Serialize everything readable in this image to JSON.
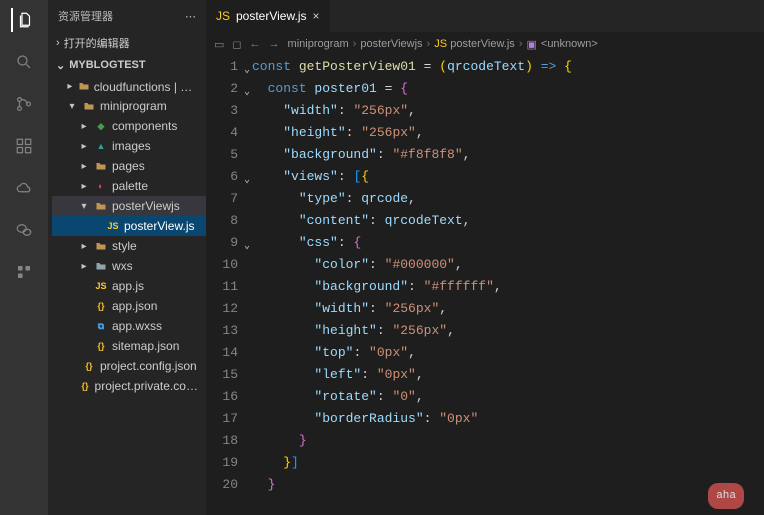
{
  "activity": {
    "icons": [
      "files",
      "search",
      "scm",
      "debug",
      "extensions",
      "cloud",
      "wechat",
      "more"
    ]
  },
  "sidebar": {
    "title": "资源管理器",
    "section_open": "打开的编辑器",
    "project": "MYBLOGTEST",
    "tree": [
      {
        "depth": 1,
        "arrow": "▸",
        "icon": "folder",
        "iconCls": "ic-folder",
        "label": "cloudfunctions | 当前环境: blo..."
      },
      {
        "depth": 1,
        "arrow": "▾",
        "icon": "folder",
        "iconCls": "ic-folder-open",
        "label": "miniprogram"
      },
      {
        "depth": 2,
        "arrow": "▸",
        "icon": "comp",
        "iconCls": "ic-comp",
        "label": "components"
      },
      {
        "depth": 2,
        "arrow": "▸",
        "icon": "img",
        "iconCls": "ic-img",
        "label": "images"
      },
      {
        "depth": 2,
        "arrow": "▸",
        "icon": "folder",
        "iconCls": "ic-folder",
        "label": "pages"
      },
      {
        "depth": 2,
        "arrow": "▸",
        "icon": "pal",
        "iconCls": "ic-pal",
        "label": "palette"
      },
      {
        "depth": 2,
        "arrow": "▾",
        "icon": "folder",
        "iconCls": "ic-folder-open",
        "label": "posterViewjs",
        "selected": true
      },
      {
        "depth": 3,
        "arrow": "",
        "icon": "js",
        "iconCls": "ic-js",
        "label": "posterView.js",
        "active": true
      },
      {
        "depth": 2,
        "arrow": "▸",
        "icon": "folder",
        "iconCls": "ic-folder",
        "label": "style"
      },
      {
        "depth": 2,
        "arrow": "▸",
        "icon": "folder",
        "iconCls": "ic-grey",
        "label": "wxs"
      },
      {
        "depth": 2,
        "arrow": "",
        "icon": "js",
        "iconCls": "ic-js",
        "label": "app.js"
      },
      {
        "depth": 2,
        "arrow": "",
        "icon": "json",
        "iconCls": "ic-json",
        "label": "app.json"
      },
      {
        "depth": 2,
        "arrow": "",
        "icon": "wxss",
        "iconCls": "ic-wxss",
        "label": "app.wxss"
      },
      {
        "depth": 2,
        "arrow": "",
        "icon": "json",
        "iconCls": "ic-json",
        "label": "sitemap.json"
      },
      {
        "depth": 1,
        "arrow": "",
        "icon": "json",
        "iconCls": "ic-json",
        "label": "project.config.json"
      },
      {
        "depth": 1,
        "arrow": "",
        "icon": "json",
        "iconCls": "ic-json",
        "label": "project.private.config.json"
      }
    ]
  },
  "tabs": [
    {
      "icon": "js",
      "label": "posterView.js"
    }
  ],
  "breadcrumb": {
    "items": [
      {
        "label": "miniprogram"
      },
      {
        "label": "posterViewjs"
      },
      {
        "icon": "js",
        "label": "posterView.js"
      },
      {
        "icon": "fn",
        "label": "<unknown>"
      }
    ]
  },
  "code": {
    "lines": [
      {
        "n": 1,
        "indent": 0,
        "fold": "▾",
        "tokens": [
          [
            "const ",
            "tk-kw"
          ],
          [
            "getPosterView01",
            "tk-fn"
          ],
          [
            " = ",
            "tk-punct"
          ],
          [
            "(",
            "tk-brace1"
          ],
          [
            "qrcodeText",
            "tk-ident"
          ],
          [
            ")",
            "tk-brace1"
          ],
          [
            " => ",
            "tk-kw"
          ],
          [
            "{",
            "tk-brace1"
          ]
        ]
      },
      {
        "n": 2,
        "indent": 1,
        "fold": "▾",
        "tokens": [
          [
            "const ",
            "tk-kw"
          ],
          [
            "poster01",
            "tk-var"
          ],
          [
            " = ",
            "tk-punct"
          ],
          [
            "{",
            "tk-brace2"
          ]
        ]
      },
      {
        "n": 3,
        "indent": 2,
        "tokens": [
          [
            "\"width\"",
            "tk-prop"
          ],
          [
            ": ",
            "tk-punct"
          ],
          [
            "\"256px\"",
            "tk-str"
          ],
          [
            ",",
            "tk-punct"
          ]
        ]
      },
      {
        "n": 4,
        "indent": 2,
        "tokens": [
          [
            "\"height\"",
            "tk-prop"
          ],
          [
            ": ",
            "tk-punct"
          ],
          [
            "\"256px\"",
            "tk-str"
          ],
          [
            ",",
            "tk-punct"
          ]
        ]
      },
      {
        "n": 5,
        "indent": 2,
        "tokens": [
          [
            "\"background\"",
            "tk-prop"
          ],
          [
            ": ",
            "tk-punct"
          ],
          [
            "\"#f8f8f8\"",
            "tk-str"
          ],
          [
            ",",
            "tk-punct"
          ]
        ]
      },
      {
        "n": 6,
        "indent": 2,
        "fold": "▾",
        "tokens": [
          [
            "\"views\"",
            "tk-prop"
          ],
          [
            ": ",
            "tk-punct"
          ],
          [
            "[",
            "tk-brace3"
          ],
          [
            "{",
            "tk-brace1"
          ]
        ]
      },
      {
        "n": 7,
        "indent": 3,
        "tokens": [
          [
            "\"type\"",
            "tk-prop"
          ],
          [
            ": ",
            "tk-punct"
          ],
          [
            "qrcode",
            "tk-ident"
          ],
          [
            ",",
            "tk-punct"
          ]
        ]
      },
      {
        "n": 8,
        "indent": 3,
        "tokens": [
          [
            "\"content\"",
            "tk-prop"
          ],
          [
            ": ",
            "tk-punct"
          ],
          [
            "qrcodeText",
            "tk-ident"
          ],
          [
            ",",
            "tk-punct"
          ]
        ]
      },
      {
        "n": 9,
        "indent": 3,
        "fold": "▾",
        "tokens": [
          [
            "\"css\"",
            "tk-prop"
          ],
          [
            ": ",
            "tk-punct"
          ],
          [
            "{",
            "tk-brace2"
          ]
        ]
      },
      {
        "n": 10,
        "indent": 4,
        "tokens": [
          [
            "\"color\"",
            "tk-prop"
          ],
          [
            ": ",
            "tk-punct"
          ],
          [
            "\"#000000\"",
            "tk-str"
          ],
          [
            ",",
            "tk-punct"
          ]
        ]
      },
      {
        "n": 11,
        "indent": 4,
        "tokens": [
          [
            "\"background\"",
            "tk-prop"
          ],
          [
            ": ",
            "tk-punct"
          ],
          [
            "\"#ffffff\"",
            "tk-str"
          ],
          [
            ",",
            "tk-punct"
          ]
        ]
      },
      {
        "n": 12,
        "indent": 4,
        "tokens": [
          [
            "\"width\"",
            "tk-prop"
          ],
          [
            ": ",
            "tk-punct"
          ],
          [
            "\"256px\"",
            "tk-str"
          ],
          [
            ",",
            "tk-punct"
          ]
        ]
      },
      {
        "n": 13,
        "indent": 4,
        "tokens": [
          [
            "\"height\"",
            "tk-prop"
          ],
          [
            ": ",
            "tk-punct"
          ],
          [
            "\"256px\"",
            "tk-str"
          ],
          [
            ",",
            "tk-punct"
          ]
        ]
      },
      {
        "n": 14,
        "indent": 4,
        "tokens": [
          [
            "\"top\"",
            "tk-prop"
          ],
          [
            ": ",
            "tk-punct"
          ],
          [
            "\"0px\"",
            "tk-str"
          ],
          [
            ",",
            "tk-punct"
          ]
        ]
      },
      {
        "n": 15,
        "indent": 4,
        "tokens": [
          [
            "\"left\"",
            "tk-prop"
          ],
          [
            ": ",
            "tk-punct"
          ],
          [
            "\"0px\"",
            "tk-str"
          ],
          [
            ",",
            "tk-punct"
          ]
        ]
      },
      {
        "n": 16,
        "indent": 4,
        "tokens": [
          [
            "\"rotate\"",
            "tk-prop"
          ],
          [
            ": ",
            "tk-punct"
          ],
          [
            "\"0\"",
            "tk-str"
          ],
          [
            ",",
            "tk-punct"
          ]
        ]
      },
      {
        "n": 17,
        "indent": 4,
        "tokens": [
          [
            "\"borderRadius\"",
            "tk-prop"
          ],
          [
            ": ",
            "tk-punct"
          ],
          [
            "\"0px\"",
            "tk-str"
          ]
        ]
      },
      {
        "n": 18,
        "indent": 3,
        "tokens": [
          [
            "}",
            "tk-brace2"
          ]
        ]
      },
      {
        "n": 19,
        "indent": 2,
        "tokens": [
          [
            "}",
            "tk-brace1"
          ],
          [
            "]",
            "tk-brace3"
          ]
        ]
      },
      {
        "n": 20,
        "indent": 1,
        "tokens": [
          [
            "}",
            "tk-brace2"
          ]
        ]
      }
    ]
  },
  "badge": "aha"
}
